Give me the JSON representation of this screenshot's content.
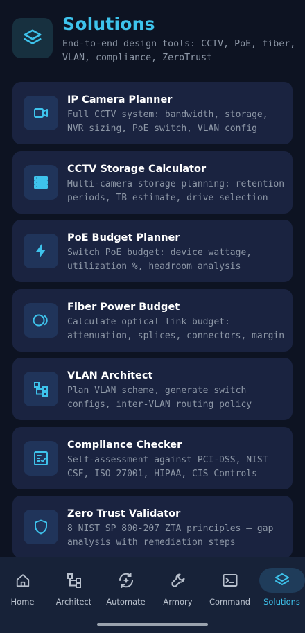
{
  "header": {
    "title": "Solutions",
    "subtitle": "End-to-end design tools: CCTV, PoE, fiber, VLAN, compliance, ZeroTrust",
    "icon": "layers-icon"
  },
  "tools": [
    {
      "title": "IP Camera Planner",
      "description": "Full CCTV system: bandwidth, storage, NVR sizing, PoE switch, VLAN config",
      "icon": "video-camera-icon"
    },
    {
      "title": "CCTV Storage Calculator",
      "description": "Multi-camera storage planning: retention periods, TB estimate, drive selection",
      "icon": "server-icon"
    },
    {
      "title": "PoE Budget Planner",
      "description": "Switch PoE budget: device wattage, utilization %, headroom analysis",
      "icon": "lightning-icon"
    },
    {
      "title": "Fiber Power Budget",
      "description": "Calculate optical link budget: attenuation, splices, connectors, margin",
      "icon": "fiber-optic-icon"
    },
    {
      "title": "VLAN Architect",
      "description": "Plan VLAN scheme, generate switch configs, inter-VLAN routing policy",
      "icon": "network-tree-icon"
    },
    {
      "title": "Compliance Checker",
      "description": "Self-assessment against PCI-DSS, NIST CSF, ISO 27001, HIPAA, CIS Controls",
      "icon": "checklist-icon"
    },
    {
      "title": "Zero Trust Validator",
      "description": "8 NIST SP 800-207 ZTA principles — gap analysis with remediation steps",
      "icon": "shield-icon"
    }
  ],
  "nav": [
    {
      "label": "Home",
      "icon": "home-icon"
    },
    {
      "label": "Architect",
      "icon": "network-tree-icon"
    },
    {
      "label": "Automate",
      "icon": "automation-icon"
    },
    {
      "label": "Armory",
      "icon": "wrench-icon"
    },
    {
      "label": "Command",
      "icon": "terminal-icon"
    },
    {
      "label": "Solutions",
      "icon": "layers-icon"
    }
  ],
  "active_nav": "Solutions",
  "colors": {
    "accent": "#3ec3ec",
    "background": "#0d1322",
    "card": "#1a2340",
    "muted_text": "#8d97a6"
  }
}
